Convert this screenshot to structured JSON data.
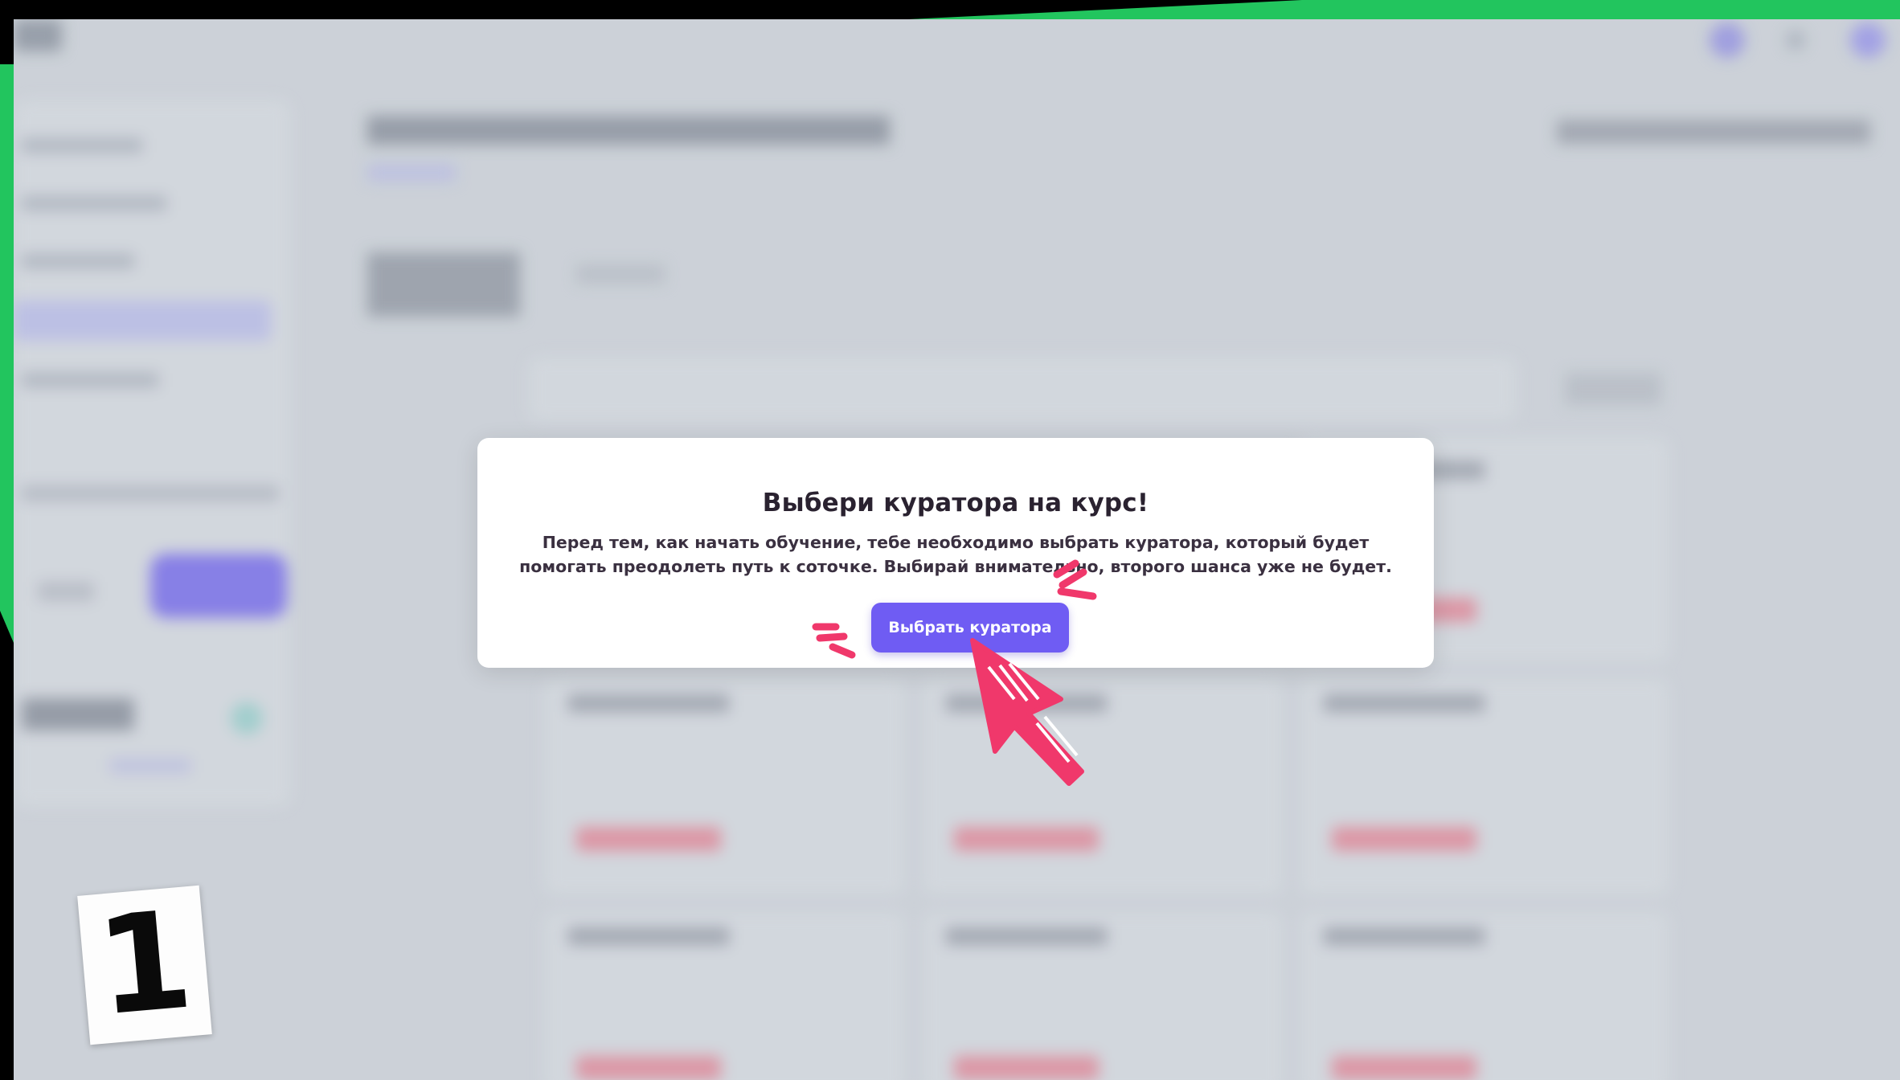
{
  "modal": {
    "title": "Выбери куратора на курс!",
    "body_line1": "Перед тем, как начать обучение, тебе необходимо выбрать куратора, который будет",
    "body_line2": "помогать преодолеть путь к соточке. Выбирай внимательно, второго шанса уже не будет.",
    "button_label": "Выбрать куратора"
  },
  "step_badge": {
    "number": "1"
  },
  "colors": {
    "accent": "#6f5cf3",
    "frame_green": "#22c55e",
    "annotation_pink": "#f0386b",
    "background_dim": "#d6dbe0"
  },
  "icons": [
    "pointer-arrow-icon",
    "sparkle-lines-icon"
  ]
}
